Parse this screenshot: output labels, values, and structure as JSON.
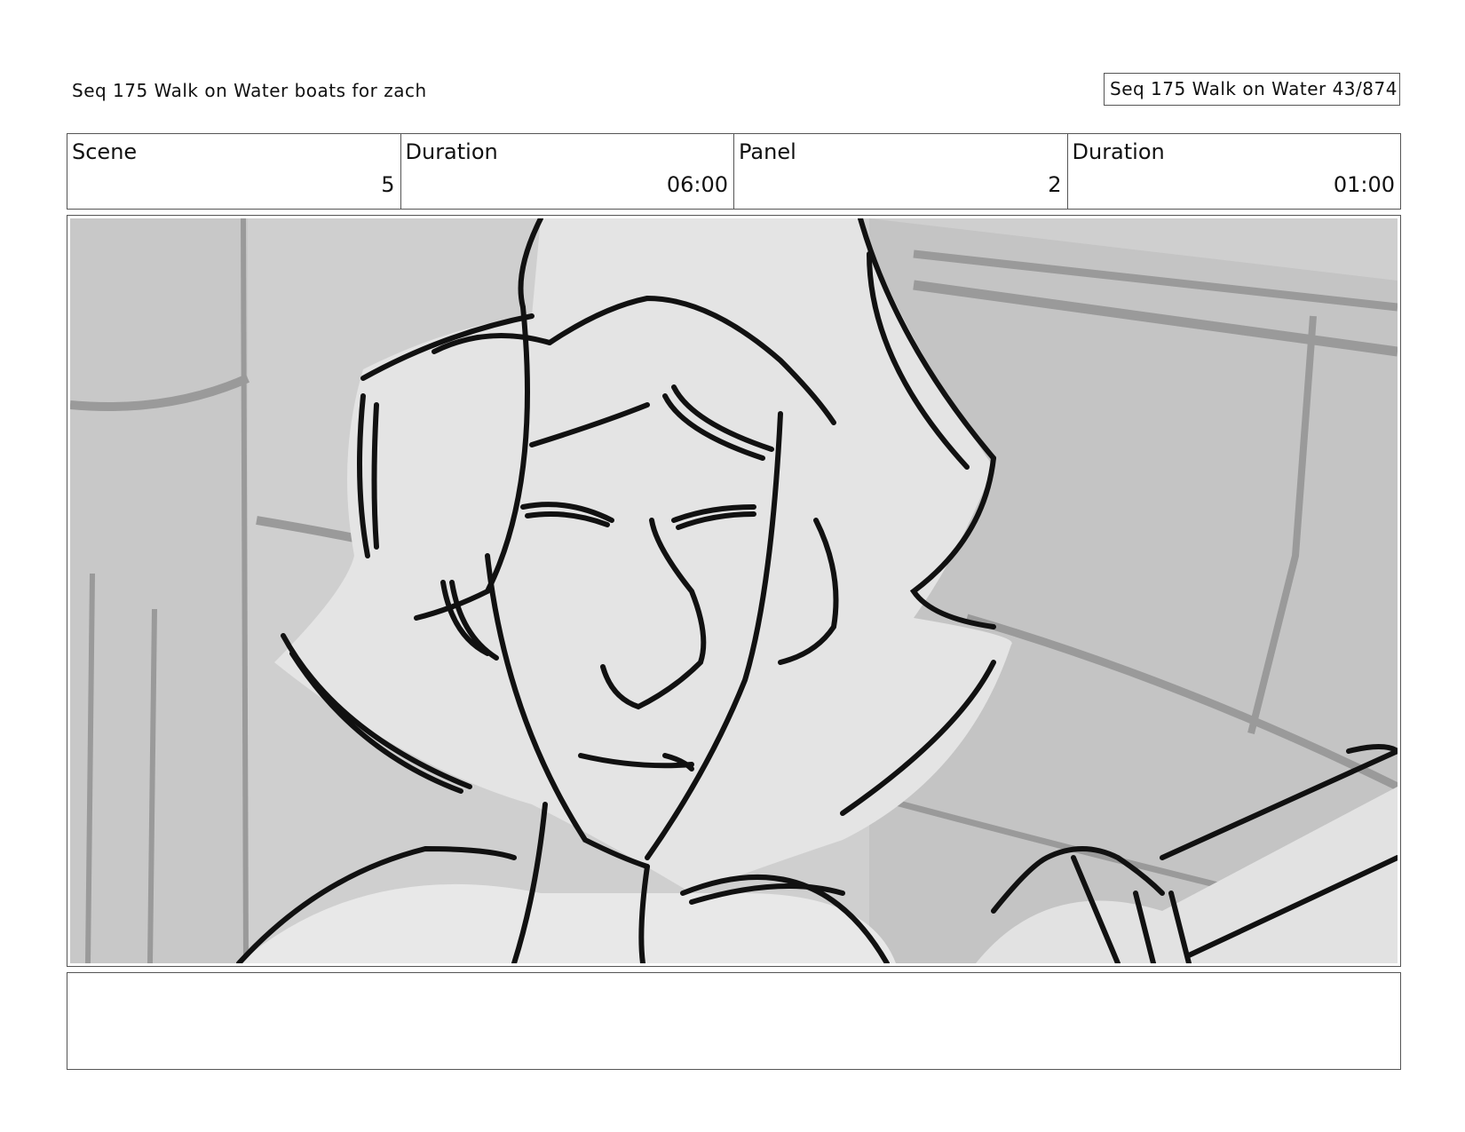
{
  "header": {
    "left_title": "Seq 175 Walk on Water  boats for zach",
    "right_label": "Seq 175 Walk on Water  43/874"
  },
  "info": {
    "scene_label": "Scene",
    "scene_value": "5",
    "scene_duration_label": "Duration",
    "scene_duration_value": "06:00",
    "panel_label": "Panel",
    "panel_value": "2",
    "panel_duration_label": "Duration",
    "panel_duration_value": "01:00"
  },
  "panel": {
    "image": "storyboard-sketch-character-face-closeup"
  },
  "notes": {
    "text": ""
  }
}
